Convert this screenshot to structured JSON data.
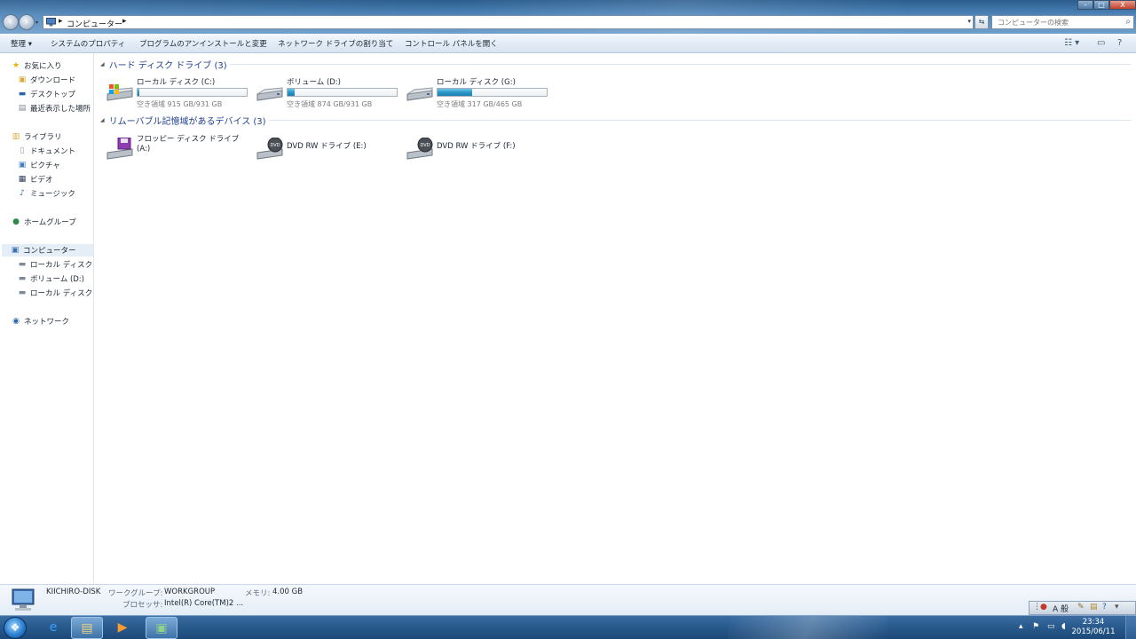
{
  "window": {
    "address": {
      "root_label": "コンピューター",
      "separator": "▸"
    },
    "search_placeholder": "コンピューターの検索",
    "controls": {
      "minimize": "–",
      "maximize": "□",
      "close": "X"
    }
  },
  "command_bar": {
    "organize": "整理 ▾",
    "system_properties": "システムのプロパティ",
    "uninstall": "プログラムのアンインストールと変更",
    "map_network_drive": "ネットワーク ドライブの割り当て",
    "open_control_panel": "コントロール パネルを開く"
  },
  "sidebar": {
    "favorites": {
      "label": "お気に入り",
      "items": [
        "ダウンロード",
        "デスクトップ",
        "最近表示した場所"
      ]
    },
    "libraries": {
      "label": "ライブラリ",
      "items": [
        "ドキュメント",
        "ピクチャ",
        "ビデオ",
        "ミュージック"
      ]
    },
    "homegroup": "ホームグループ",
    "computer": {
      "label": "コンピューター",
      "items": [
        "ローカル ディスク (",
        "ボリューム (D:)",
        "ローカル ディスク ("
      ]
    },
    "network": "ネットワーク"
  },
  "groups": {
    "hard_disks": {
      "header": "ハード ディスク ドライブ (3)",
      "drives": [
        {
          "name": "ローカル ディスク (C:)",
          "free": "空き領域 915 GB/931 GB",
          "used_fraction": 0.017
        },
        {
          "name": "ボリューム (D:)",
          "free": "空き領域 874 GB/931 GB",
          "used_fraction": 0.061
        },
        {
          "name": "ローカル ディスク (G:)",
          "free": "空き領域 317 GB/465 GB",
          "used_fraction": 0.318
        }
      ]
    },
    "removable": {
      "header": "リムーバブル記憶域があるデバイス (3)",
      "devices": [
        {
          "name_line1": "フロッピー ディスク ドライブ",
          "name_line2": "(A:)"
        },
        {
          "name": "DVD RW ドライブ (E:)"
        },
        {
          "name": "DVD RW ドライブ (F:)"
        }
      ]
    }
  },
  "details": {
    "computer_name": "KIICHIRO-DISK",
    "workgroup_label": "ワークグループ:",
    "workgroup_value": "WORKGROUP",
    "memory_label": "メモリ:",
    "memory_value": "4.00 GB",
    "processor_label": "プロセッサ:",
    "processor_value": "Intel(R) Core(TM)2 ..."
  },
  "taskbar": {
    "time": "23:34",
    "date": "2015/06/11",
    "ime_mode": "A 般"
  },
  "colors": {
    "title_bar": "#4e86bb",
    "command_bar": "#e3ecf6",
    "group_header_text": "#1e3f8f",
    "usage_bar_fill": "#2a97c7",
    "taskbar": "#2b5d91"
  }
}
